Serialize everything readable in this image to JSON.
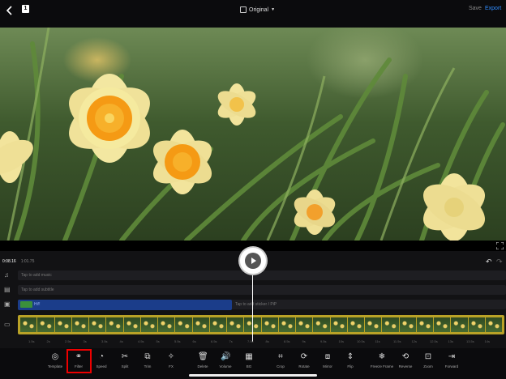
{
  "topbar": {
    "aspect_label": "Original",
    "save_label": "Save",
    "export_label": "Export",
    "page_badge": "1"
  },
  "timeline": {
    "current_time": "0:08.16",
    "total_time": "1:01.75",
    "music_placeholder": "Tap to add music",
    "subtitle_placeholder": "Tap to add subtitle",
    "text_clip_label": "Hi!!",
    "sticker_placeholder": "Tap to add sticker / PiP"
  },
  "toolbar": {
    "items": [
      {
        "label": "Template",
        "icon": "template-icon",
        "glyph": "◎"
      },
      {
        "label": "Filter",
        "icon": "filter-icon",
        "glyph": "⚭"
      },
      {
        "label": "Speed",
        "icon": "speed-icon",
        "glyph": "◔"
      },
      {
        "label": "Split",
        "icon": "split-icon",
        "glyph": "✂"
      },
      {
        "label": "Trim",
        "icon": "trim-icon",
        "glyph": "⧉"
      },
      {
        "label": "FX",
        "icon": "fx-icon",
        "glyph": "✧"
      },
      {
        "label": "Delete",
        "icon": "delete-icon",
        "glyph": "🗑"
      },
      {
        "label": "Volume",
        "icon": "volume-icon",
        "glyph": "🔊"
      },
      {
        "label": "BG",
        "icon": "background-icon",
        "glyph": "▦"
      },
      {
        "label": "Crop",
        "icon": "crop-icon",
        "glyph": "⌗"
      },
      {
        "label": "Rotate",
        "icon": "rotate-icon",
        "glyph": "⟳"
      },
      {
        "label": "Mirror",
        "icon": "mirror-icon",
        "glyph": "⧈"
      },
      {
        "label": "Flip",
        "icon": "flip-icon",
        "glyph": "⇕"
      },
      {
        "label": "Freeze Frame",
        "icon": "freeze-frame-icon",
        "glyph": "❄"
      },
      {
        "label": "Reverse",
        "icon": "reverse-icon",
        "glyph": "⟲"
      },
      {
        "label": "Zoom",
        "icon": "zoom-icon",
        "glyph": "⊡"
      },
      {
        "label": "Forward",
        "icon": "forward-icon",
        "glyph": "⇥"
      }
    ]
  },
  "ruler_ticks": [
    "1.5s",
    "2s",
    "2.5s",
    "3s",
    "3.5s",
    "4s",
    "4.5s",
    "5s",
    "5.5s",
    "6s",
    "6.5s",
    "7s",
    "7.5s",
    "8s",
    "8.5s",
    "9s",
    "9.5s",
    "10s",
    "10.5s",
    "11s",
    "11.5s",
    "12s",
    "12.5s",
    "13s",
    "13.5s",
    "14s"
  ],
  "colors": {
    "accent": "#2f8cff",
    "text_clip": "#1b3d8a",
    "filmstrip_border": "#b9a227",
    "highlight_box": "#e00000"
  }
}
